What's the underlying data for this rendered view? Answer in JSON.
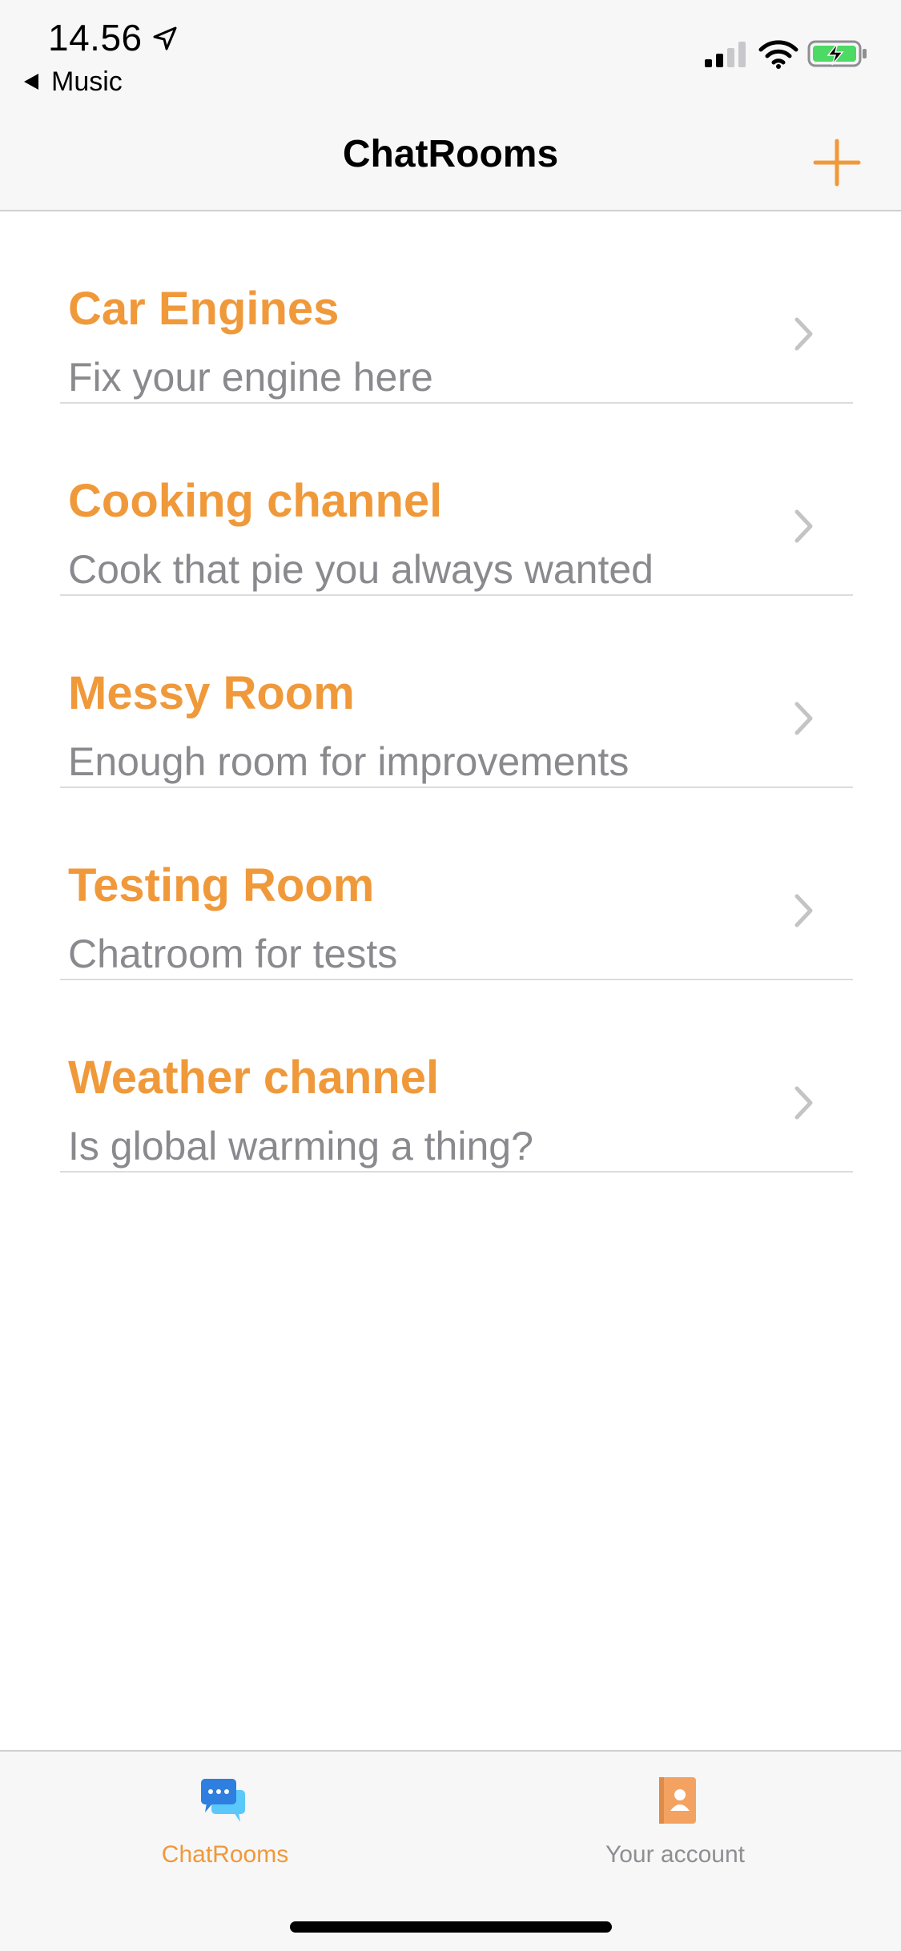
{
  "status_bar": {
    "time": "14.56",
    "back_app": "Music",
    "icons": [
      "location-icon",
      "signal-icon",
      "wifi-icon",
      "battery-charging-icon"
    ]
  },
  "nav": {
    "title": "ChatRooms",
    "add_icon": "plus-icon",
    "accent_color": "#f0993a"
  },
  "rooms": [
    {
      "title": "Car Engines",
      "subtitle": "Fix your engine here"
    },
    {
      "title": "Cooking channel",
      "subtitle": "Cook that pie you always wanted"
    },
    {
      "title": "Messy Room",
      "subtitle": "Enough room for improvements"
    },
    {
      "title": "Testing Room",
      "subtitle": "Chatroom for tests"
    },
    {
      "title": "Weather channel",
      "subtitle": "Is global warming a thing?"
    }
  ],
  "tabs": [
    {
      "label": "ChatRooms",
      "icon": "chat-bubbles-icon",
      "selected": true
    },
    {
      "label": "Your account",
      "icon": "contact-book-icon",
      "selected": false
    }
  ],
  "colors": {
    "accent": "#f0993a",
    "subtitle": "#8a8a8e",
    "divider": "#dcdcdf",
    "chevron": "#c4c4c7",
    "battery": "#4cd964"
  }
}
